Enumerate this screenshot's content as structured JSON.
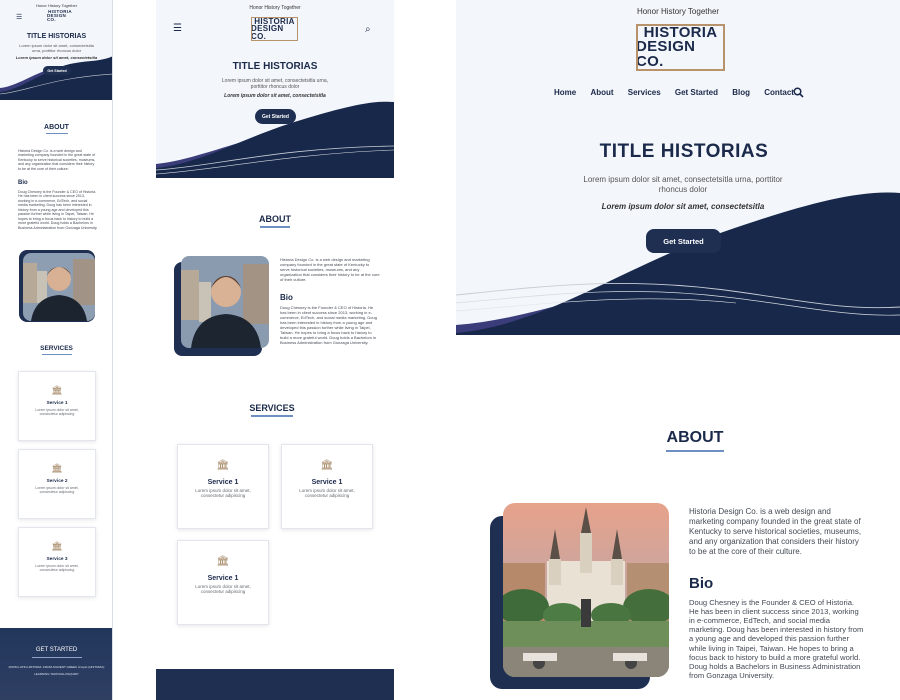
{
  "brand": {
    "tagline": "Honor History Together",
    "logo_line1": "HISTORIA",
    "logo_line2": "DESIGN CO."
  },
  "nav": {
    "items": [
      "Home",
      "About",
      "Services",
      "Get Started",
      "Blog",
      "Contact"
    ]
  },
  "hero": {
    "title": "TITLE HISTORIAS",
    "subtitle": "Lorem ipsum dolor sit amet, consectetsitla urna, porttitor rhoncus dolor",
    "emphasis": "Lorem ipsum dolor sit amet, consectetsitla",
    "cta": "Get Started"
  },
  "about": {
    "heading": "ABOUT",
    "intro": "Historia Design Co. is a web design and marketing company founded in the great state of Kentucky to serve historical societies, museums, and any organization that considers their history to be at the core of their culture.",
    "bio_heading": "Bio",
    "bio": "Doug Chesney is the Founder & CEO of Historia. He has been in client success since 2013, working in e-commerce, EdTech, and social media marketing. Doug has been interested in history from a young age and developed this passion further while living in Taipei, Taiwan. He hopes to bring a focus back to history to build a more grateful world. Doug holds a Bachelors in Business Administration from Gonzaga University."
  },
  "services": {
    "heading": "SERVICES",
    "mobile_items": [
      {
        "title": "Service 1",
        "desc": "Lorem ipsum dolor sit amet, consectetur adipiscing"
      },
      {
        "title": "Service 2",
        "desc": "Lorem ipsum dolor sit amet, consectetur adipiscing"
      },
      {
        "title": "Service 3",
        "desc": "Lorem ipsum dolor sit amet, consectetur adipiscing"
      }
    ],
    "tablet_items": [
      {
        "title": "Service 1",
        "desc": "Lorem ipsum dolor sit amet, consectetur adipiscing"
      },
      {
        "title": "Service 1",
        "desc": "Lorem ipsum dolor sit amet, consectetur adipiscing"
      },
      {
        "title": "Service 1",
        "desc": "Lorem ipsum dolor sit amet, consectetur adipiscing"
      }
    ]
  },
  "footer": {
    "heading": "GET STARTED",
    "line1": "FROM LATIN HISTORIA. FROM ANCIENT GREEK ἱστορία (HISTORIA)",
    "line2": "LEARNING THROUGH INQUIRY"
  },
  "icons": {
    "menu": "hamburger-menu-icon",
    "search": "search-icon",
    "service": "building-columns-icon"
  },
  "colors": {
    "navy": "#1b2a4a",
    "accent_gold": "#b8926a",
    "hero_bg": "#f3f6fb",
    "wave_dark": "#17284a",
    "wave_purple": "#3b3d7a"
  }
}
